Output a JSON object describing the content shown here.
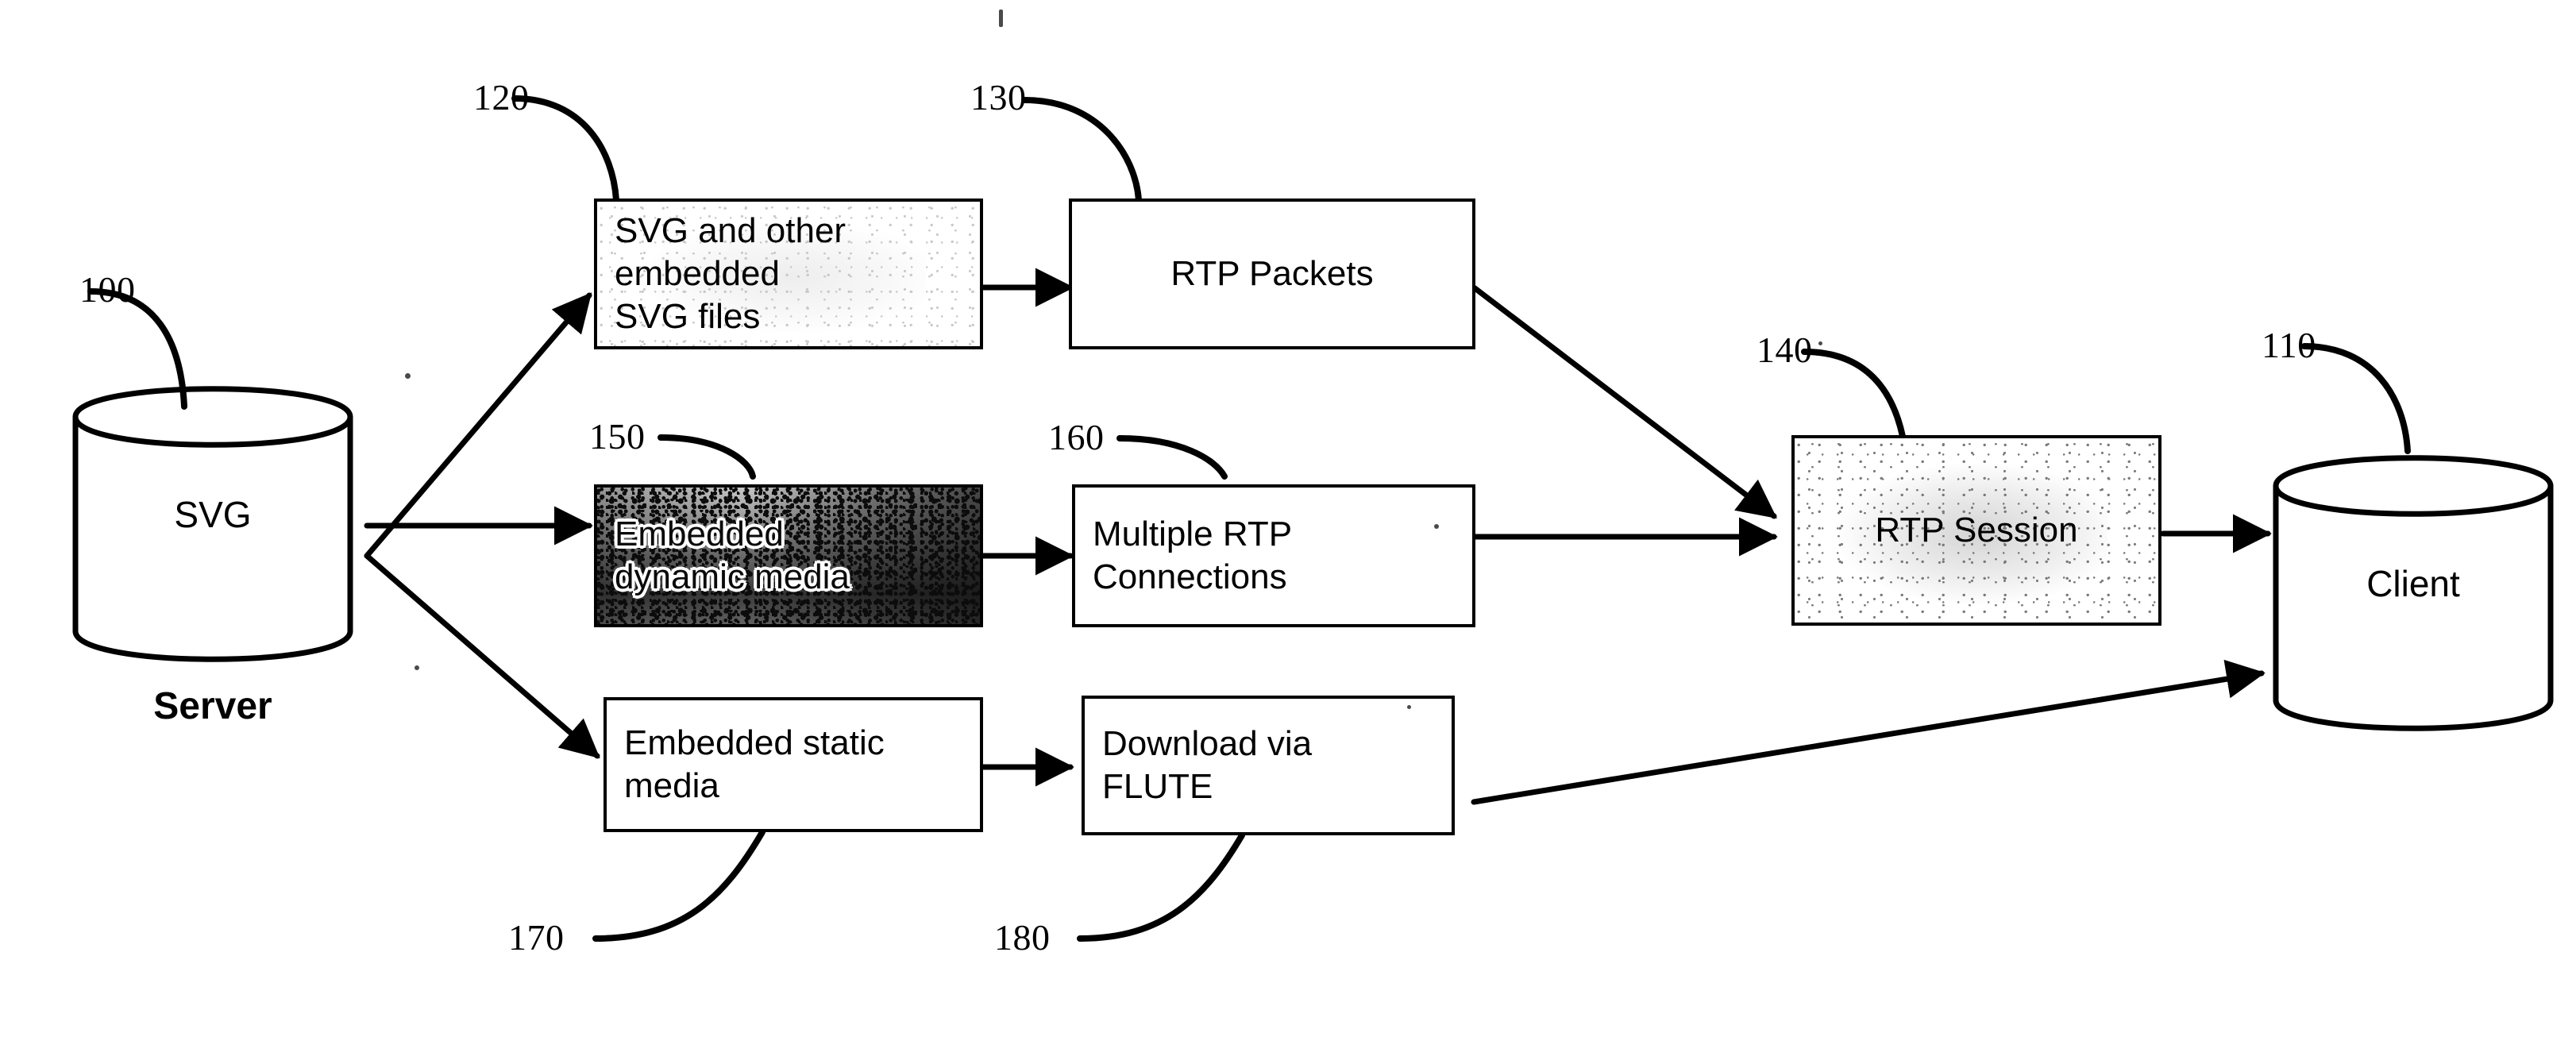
{
  "figure": {
    "title": "SVG streaming from server to client",
    "stroke_color": "#000000",
    "background_color": "#ffffff"
  },
  "nodes": {
    "server": {
      "ref": "100",
      "label": "SVG",
      "caption": "Server"
    },
    "client": {
      "ref": "110",
      "label": "Client"
    },
    "box_svg_files": {
      "ref": "120",
      "label": "SVG and other\nembedded\nSVG files",
      "align": "left",
      "fill": "white"
    },
    "box_rtp_packets": {
      "ref": "130",
      "label": "RTP Packets",
      "align": "center",
      "fill": "white"
    },
    "box_rtp_session": {
      "ref": "140",
      "label": "RTP Session",
      "align": "center",
      "fill": "light-speckle"
    },
    "box_dynamic_media": {
      "ref": "150",
      "label": "Embedded\ndynamic media",
      "align": "left",
      "fill": "dark-speckle"
    },
    "box_multiple_rtp": {
      "ref": "160",
      "label": "Multiple RTP\nConnections",
      "align": "left",
      "fill": "white"
    },
    "box_static_media": {
      "ref": "170",
      "label": "Embedded static\nmedia",
      "align": "left",
      "fill": "white"
    },
    "box_download_flute": {
      "ref": "180",
      "label": "Download via\nFLUTE",
      "align": "left",
      "fill": "white"
    }
  },
  "ref_numerals": [
    {
      "id": "ref-100",
      "text": "100"
    },
    {
      "id": "ref-110",
      "text": "110"
    },
    {
      "id": "ref-120",
      "text": "120"
    },
    {
      "id": "ref-130",
      "text": "130"
    },
    {
      "id": "ref-140",
      "text": "140"
    },
    {
      "id": "ref-150",
      "text": "150"
    },
    {
      "id": "ref-160",
      "text": "160"
    },
    {
      "id": "ref-170",
      "text": "170"
    },
    {
      "id": "ref-180",
      "text": "180"
    }
  ],
  "flows": [
    {
      "from": "server",
      "to": "box_svg_files",
      "style": "arrow-diagonal-up"
    },
    {
      "from": "server",
      "to": "box_dynamic_media",
      "style": "arrow-horizontal"
    },
    {
      "from": "server",
      "to": "box_static_media",
      "style": "arrow-diagonal-down"
    },
    {
      "from": "box_svg_files",
      "to": "box_rtp_packets",
      "style": "arrow-horizontal"
    },
    {
      "from": "box_dynamic_media",
      "to": "box_multiple_rtp",
      "style": "arrow-horizontal"
    },
    {
      "from": "box_static_media",
      "to": "box_download_flute",
      "style": "arrow-horizontal"
    },
    {
      "from": "box_rtp_packets",
      "to": "box_rtp_session",
      "style": "arrow-diagonal-down"
    },
    {
      "from": "box_multiple_rtp",
      "to": "box_rtp_session",
      "style": "arrow-horizontal"
    },
    {
      "from": "box_rtp_session",
      "to": "client",
      "style": "arrow-horizontal"
    },
    {
      "from": "box_download_flute",
      "to": "client",
      "style": "arrow-diagonal-up"
    }
  ]
}
